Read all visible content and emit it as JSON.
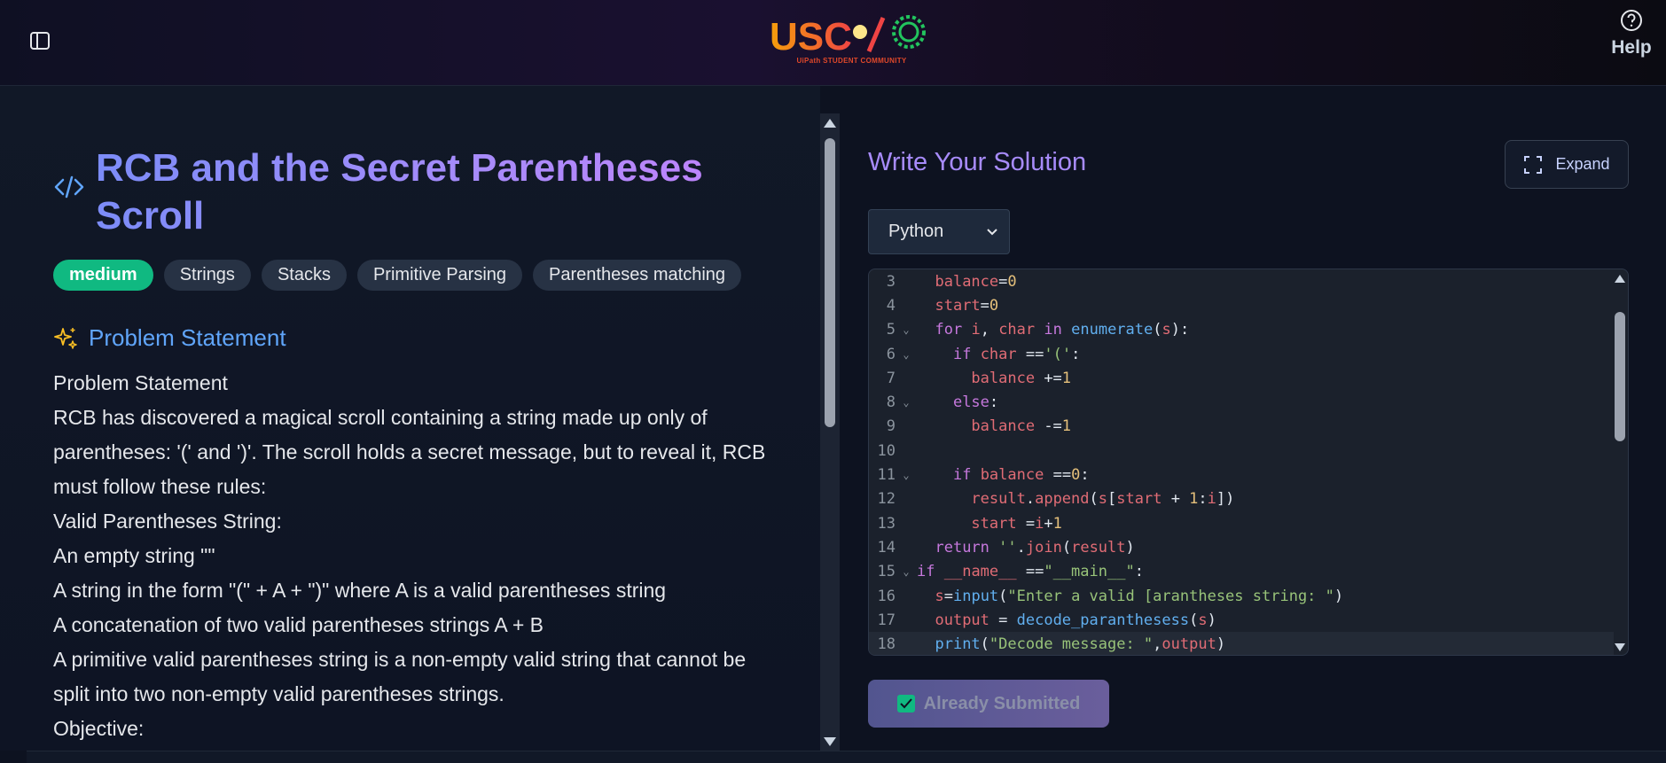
{
  "header": {
    "logo_text": "UiPath STUDENT COMMUNITY",
    "help_label": "Help"
  },
  "problem": {
    "title": "RCB and the Secret Parentheses Scroll",
    "difficulty": "medium",
    "tags": [
      "Strings",
      "Stacks",
      "Primitive Parsing",
      "Parentheses matching"
    ],
    "section_title": "Problem Statement",
    "statement_lines": [
      "Problem Statement",
      "RCB has discovered a magical scroll containing a string made up only of",
      "parentheses: '(' and ')'. The scroll holds a secret message, but to reveal it, RCB",
      "must follow these rules:",
      "Valid Parentheses String:",
      "An empty string \"\"",
      "A string in the form \"(\" + A + \")\" where A is a valid parentheses string",
      "A concatenation of two valid parentheses strings A + B",
      "A primitive valid parentheses string is a non-empty valid string that cannot be",
      "split into two non-empty valid parentheses strings.",
      "Objective:"
    ]
  },
  "solution": {
    "title": "Write Your Solution",
    "expand_label": "Expand",
    "language": "Python",
    "submit_label": "Already Submitted"
  },
  "editor": {
    "line_numbers": [
      "3",
      "4",
      "5",
      "6",
      "7",
      "8",
      "9",
      "10",
      "11",
      "12",
      "13",
      "14",
      "15",
      "16",
      "17",
      "18"
    ]
  },
  "colors": {
    "accent": "#a78bfa",
    "difficulty_badge": "#10b981",
    "section_title": "#60a5fa"
  }
}
